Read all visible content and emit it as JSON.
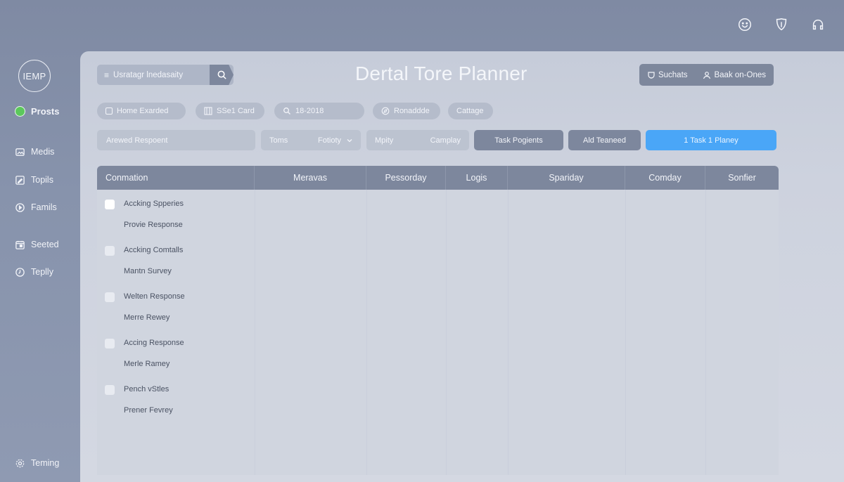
{
  "header_icons": [
    "smile-icon",
    "shield-icon",
    "headset-icon"
  ],
  "sidebar": {
    "logo": "IEMP",
    "items": [
      {
        "label": "Prosts",
        "icon": "status-dot-icon"
      },
      {
        "label": "Medis",
        "icon": "image-icon"
      },
      {
        "label": "Topils",
        "icon": "edit-icon"
      },
      {
        "label": "Famils",
        "icon": "play-circle-icon"
      },
      {
        "label": "Seeted",
        "icon": "calendar-icon"
      },
      {
        "label": "Teplly",
        "icon": "clock-icon"
      },
      {
        "label": "Teming",
        "icon": "gear-icon"
      }
    ]
  },
  "search": {
    "placeholder": "Usratagr lnedasaity"
  },
  "title": "Dertal Tore Planner",
  "top_actions": {
    "first": "Suchats",
    "second": "Baak on-Ones"
  },
  "chips": [
    "Home Exarded",
    "SSe1 Card",
    "18-2018",
    "Ronaddde",
    "Cattage"
  ],
  "controls": {
    "field": "Arewed Respoent",
    "select_left": "Toms",
    "select_value": "Fotioty",
    "seg_left": "Mpity",
    "seg_right": "Camplay",
    "btn_task": "Task Pogients",
    "btn_add": "Ald Teaneed",
    "btn_primary": "1 Task 1 Planey"
  },
  "table": {
    "columns": [
      "Conmation",
      "Meravas",
      "Pessorday",
      "Logis",
      "Spariday",
      "Comday",
      "Sonfier"
    ],
    "rows": [
      {
        "title": "Accking Spperies",
        "sub": "Provie Response"
      },
      {
        "title": "Accking Comtalls",
        "sub": "Mantn Survey"
      },
      {
        "title": "Welten Response",
        "sub": "Merre Rewey"
      },
      {
        "title": "Accing Response",
        "sub": "Merle Ramey"
      },
      {
        "title": "Pench vStles",
        "sub": "Prener Fevrey"
      }
    ]
  },
  "colors": {
    "accent": "#4aa6f7",
    "header": "#7d879d",
    "status": "#5cc85c"
  }
}
